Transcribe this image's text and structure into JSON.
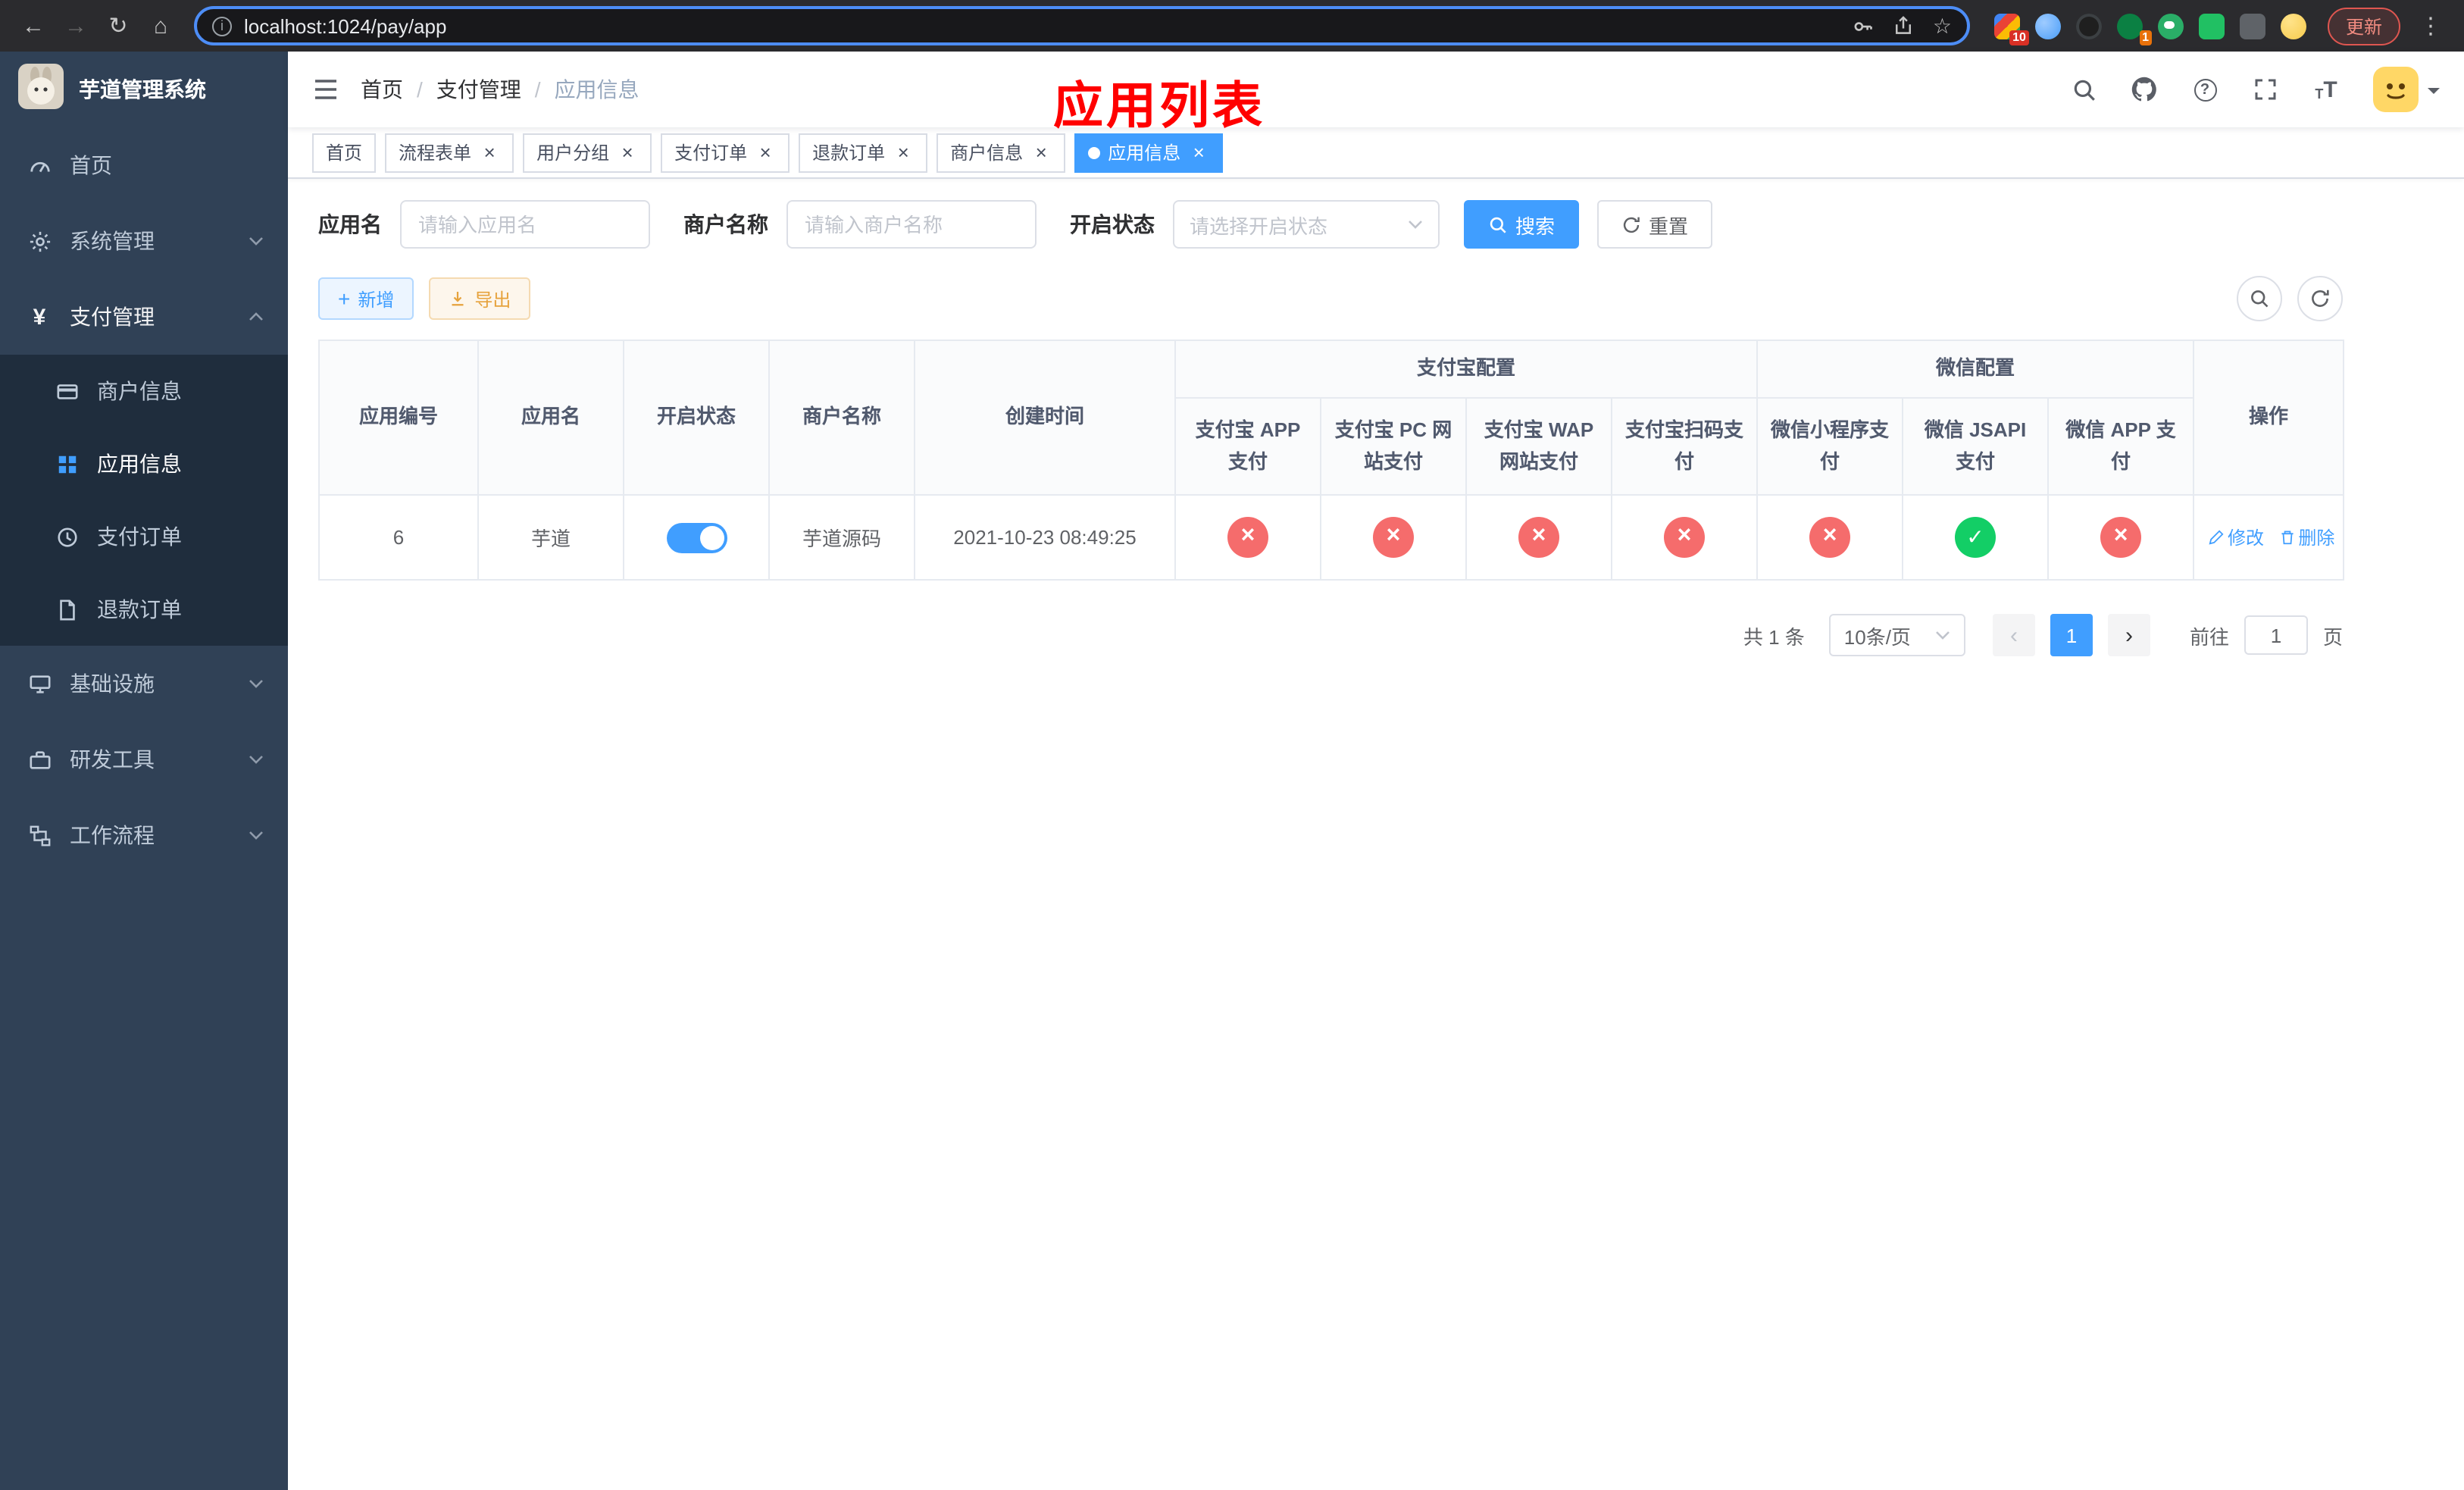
{
  "colors": {
    "accent": "#409eff",
    "danger": "#f56c6c",
    "success": "#13ce66",
    "warning": "#e6a23c",
    "annotation": "#ff0000",
    "sidebar_bg": "#304156",
    "sidebar_submenu_bg": "#1f2d3d"
  },
  "browser": {
    "url": "localhost:1024/pay/app",
    "update_label": "更新",
    "extensions_badge": "10",
    "profile_badge": "1"
  },
  "sidebar": {
    "app_title": "芋道管理系统",
    "items": {
      "home": "首页",
      "system": "系统管理",
      "payment": "支付管理",
      "merchant_info": "商户信息",
      "app_info": "应用信息",
      "pay_order": "支付订单",
      "refund_order": "退款订单",
      "infrastructure": "基础设施",
      "dev_tools": "研发工具",
      "workflow": "工作流程"
    }
  },
  "navbar": {
    "breadcrumb": [
      "首页",
      "支付管理",
      "应用信息"
    ],
    "separator": "/",
    "annotation_title": "应用列表"
  },
  "tabs": [
    {
      "label": "首页",
      "closable": false,
      "active": false
    },
    {
      "label": "流程表单",
      "closable": true,
      "active": false
    },
    {
      "label": "用户分组",
      "closable": true,
      "active": false
    },
    {
      "label": "支付订单",
      "closable": true,
      "active": false
    },
    {
      "label": "退款订单",
      "closable": true,
      "active": false
    },
    {
      "label": "商户信息",
      "closable": true,
      "active": false
    },
    {
      "label": "应用信息",
      "closable": true,
      "active": true
    }
  ],
  "filters": {
    "app_name": {
      "label": "应用名",
      "placeholder": "请输入应用名"
    },
    "merchant_name": {
      "label": "商户名称",
      "placeholder": "请输入商户名称"
    },
    "status": {
      "label": "开启状态",
      "placeholder": "请选择开启状态"
    },
    "search_label": "搜索",
    "reset_label": "重置"
  },
  "toolbar": {
    "add_label": "新增",
    "export_label": "导出"
  },
  "table": {
    "groups": {
      "alipay": "支付宝配置",
      "wechat": "微信配置"
    },
    "columns": {
      "app_id": "应用编号",
      "app_name": "应用名",
      "status": "开启状态",
      "merchant": "商户名称",
      "created_at": "创建时间",
      "alipay_app": "支付宝 APP 支付",
      "alipay_pc": "支付宝 PC 网站支付",
      "alipay_wap": "支付宝 WAP 网站支付",
      "alipay_qr": "支付宝扫码支付",
      "wx_lite": "微信小程序支付",
      "wx_jsapi": "微信 JSAPI 支付",
      "wx_app": "微信 APP 支付",
      "actions": "操作"
    },
    "rows": [
      {
        "app_id": "6",
        "app_name": "芋道",
        "status": "on",
        "merchant": "芋道源码",
        "created_at": "2021-10-23 08:49:25",
        "alipay_app": "no",
        "alipay_pc": "no",
        "alipay_wap": "no",
        "alipay_qr": "no",
        "wx_lite": "no",
        "wx_jsapi": "yes",
        "wx_app": "no",
        "edit_label": "修改",
        "delete_label": "删除"
      }
    ]
  },
  "pagination": {
    "total_label": "共 1 条",
    "page_size_label": "10条/页",
    "current_page": "1",
    "goto_label": "前往",
    "goto_value": "1",
    "goto_unit": "页"
  }
}
